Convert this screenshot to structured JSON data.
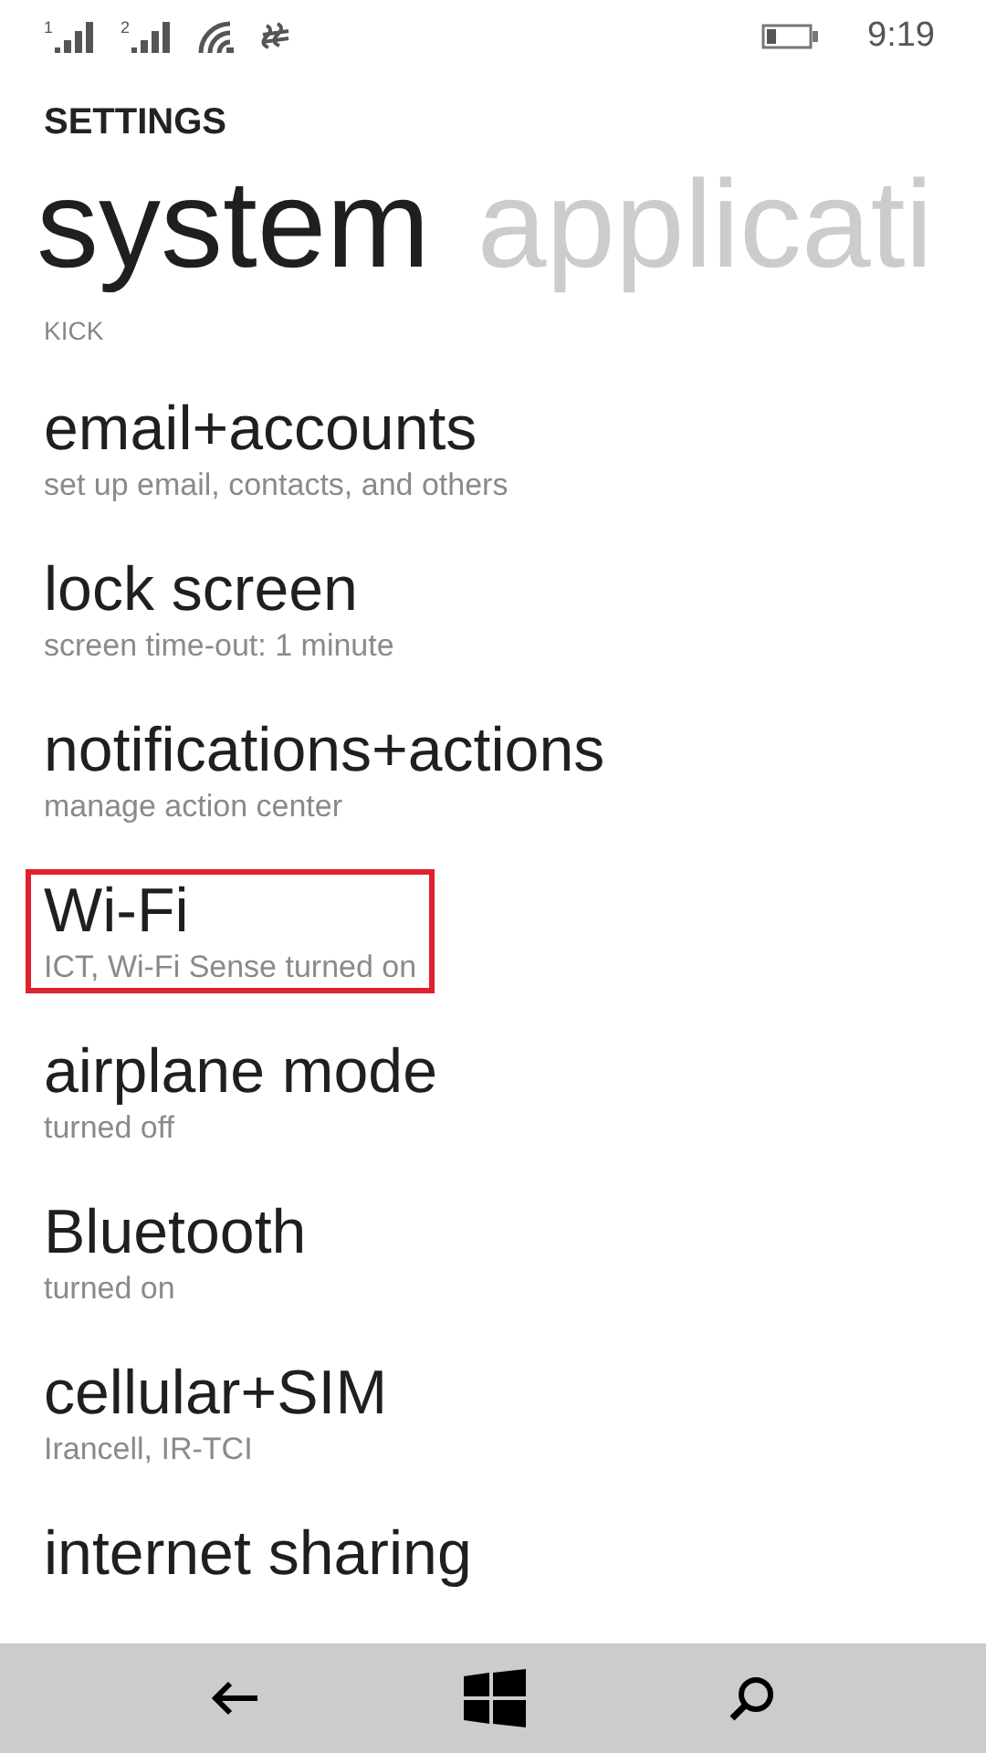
{
  "status_bar": {
    "sim_1": "1",
    "sim_2": "2",
    "time": "9:19"
  },
  "header": {
    "title": "SETTINGS",
    "pivots": [
      {
        "label": "system",
        "selected": true
      },
      {
        "label": "applicati",
        "selected": false
      }
    ]
  },
  "section_label": "KICK",
  "items": [
    {
      "title": "email+accounts",
      "subtitle": "set up email, contacts, and others",
      "highlighted": false
    },
    {
      "title": "lock screen",
      "subtitle": "screen time-out: 1 minute",
      "highlighted": false
    },
    {
      "title": "notifications+actions",
      "subtitle": "manage action center",
      "highlighted": false
    },
    {
      "title": "Wi-Fi",
      "subtitle": "ICT, Wi-Fi Sense turned on",
      "highlighted": true
    },
    {
      "title": "airplane mode",
      "subtitle": "turned off",
      "highlighted": false
    },
    {
      "title": "Bluetooth",
      "subtitle": "turned on",
      "highlighted": false
    },
    {
      "title": "cellular+SIM",
      "subtitle": "Irancell, IR-TCI",
      "highlighted": false
    },
    {
      "title": "internet sharing",
      "highlighted": false
    }
  ]
}
